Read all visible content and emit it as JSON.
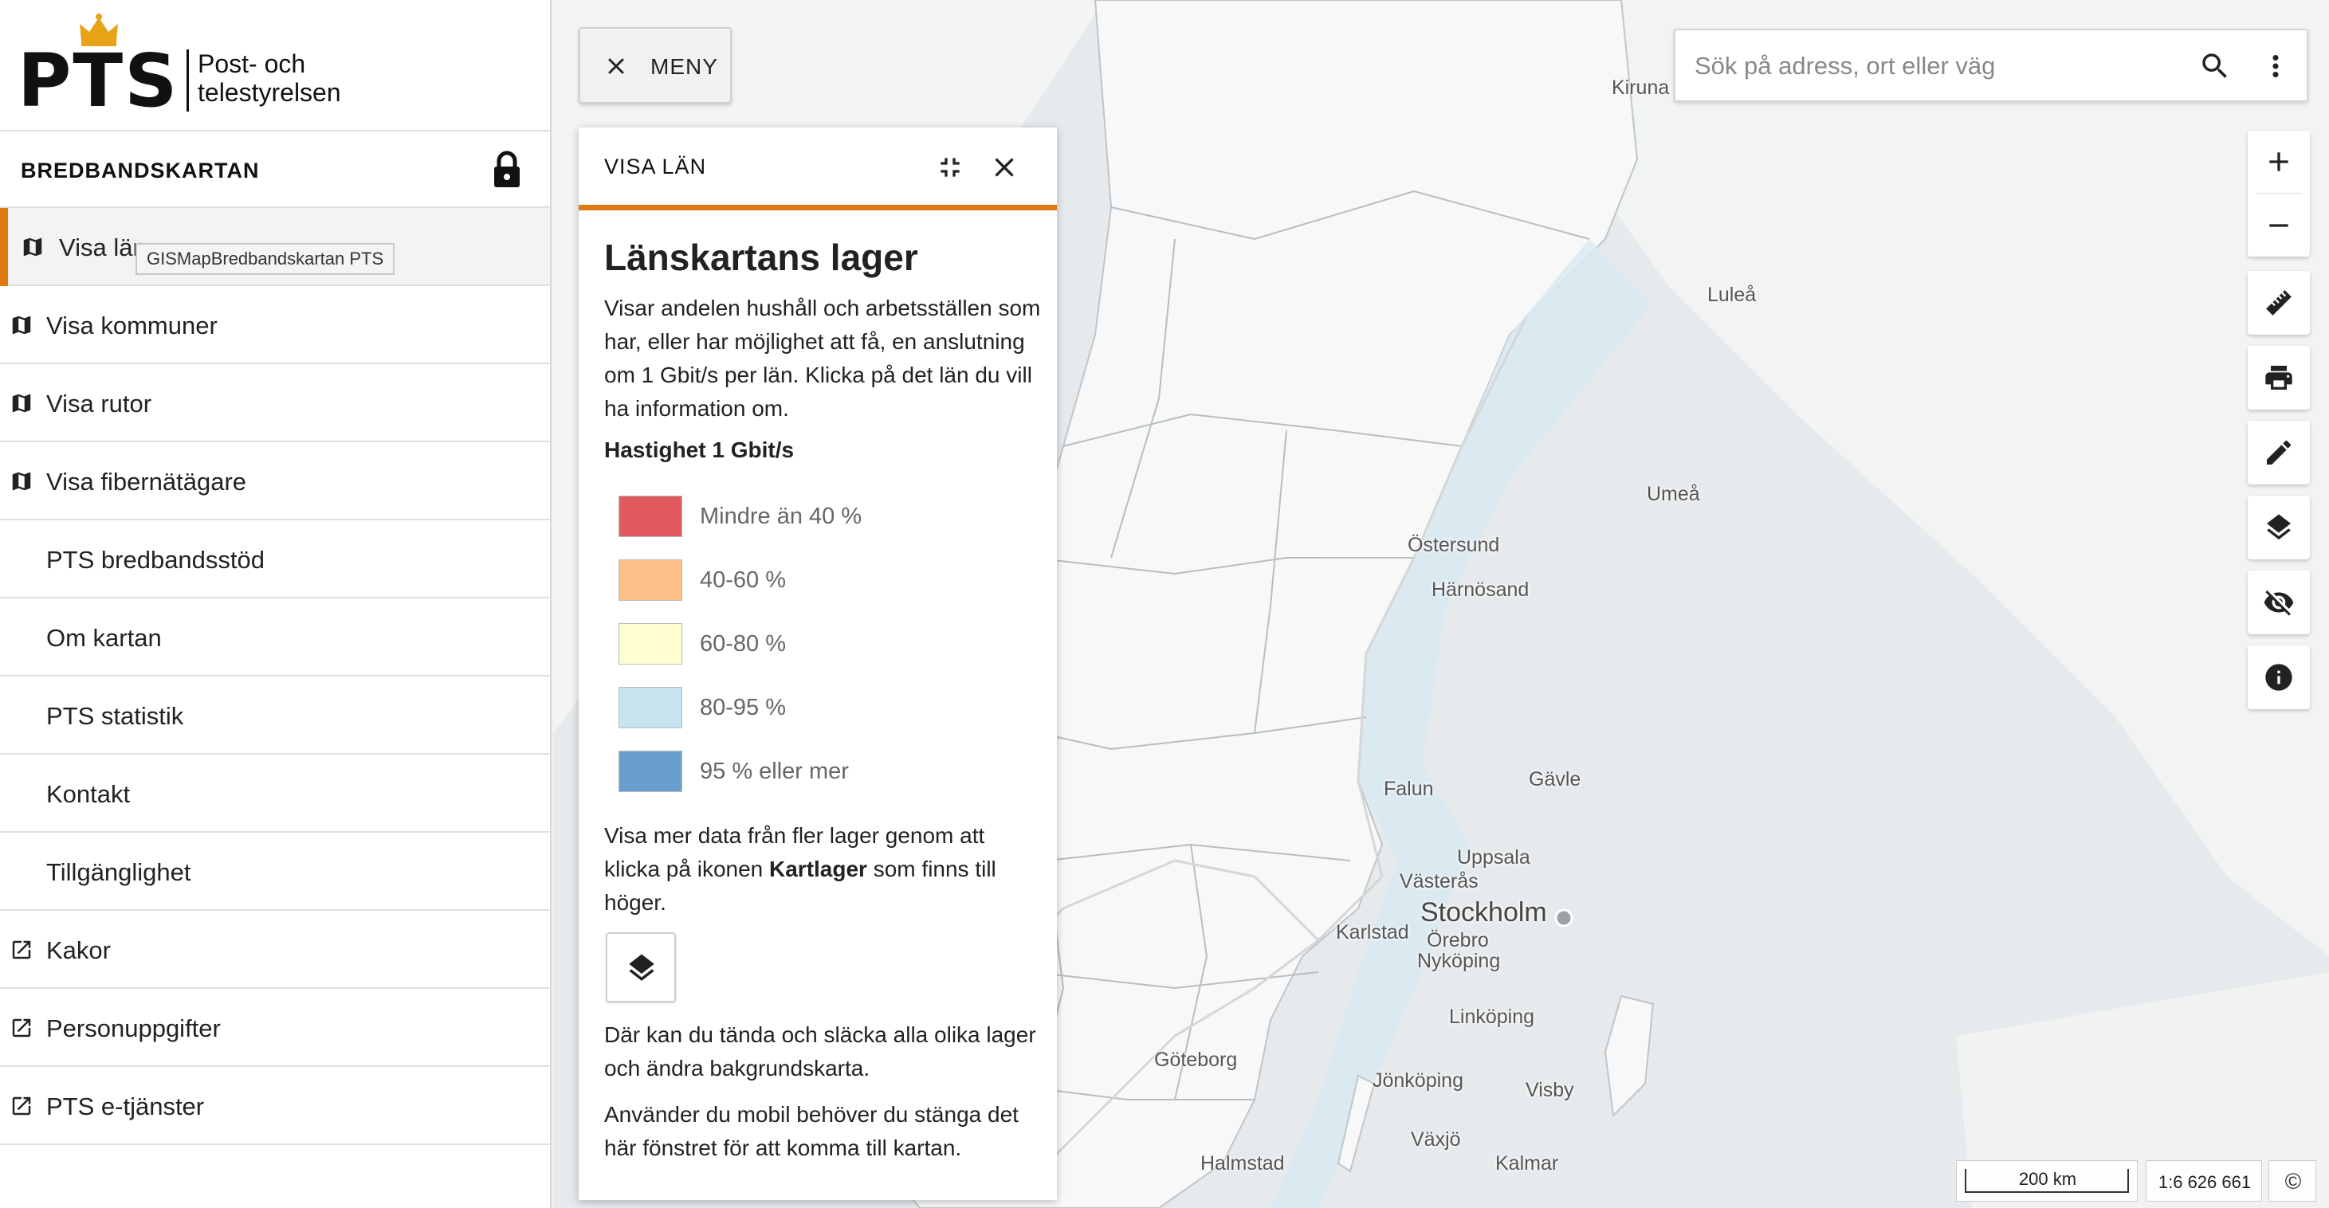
{
  "sidebar": {
    "logo": {
      "wordmark": "PTS",
      "name_line1": "Post- och",
      "name_line2": "telestyrelsen"
    },
    "header_title": "BREDBANDSKARTAN",
    "items": [
      {
        "label": "Visa län",
        "icon": "map-icon"
      },
      {
        "label": "Visa kommuner",
        "icon": "map-icon"
      },
      {
        "label": "Visa rutor",
        "icon": "map-icon"
      },
      {
        "label": "Visa fibernätägare",
        "icon": "map-icon"
      },
      {
        "label": "PTS bredbandsstöd",
        "icon": ""
      },
      {
        "label": "Om kartan",
        "icon": ""
      },
      {
        "label": "PTS statistik",
        "icon": ""
      },
      {
        "label": "Kontakt",
        "icon": ""
      },
      {
        "label": "Tillgänglighet",
        "icon": ""
      },
      {
        "label": "Kakor",
        "icon": "external-link-icon"
      },
      {
        "label": "Personuppgifter",
        "icon": "external-link-icon"
      },
      {
        "label": "PTS e-tjänster",
        "icon": "external-link-icon"
      }
    ],
    "tooltip": "GISMapBredbandskartan PTS"
  },
  "menu_button": {
    "label": "MENY"
  },
  "panel": {
    "header_title": "VISA LÄN",
    "heading": "Länskartans lager",
    "description": "Visar andelen hushåll och arbetsställen som har, eller har möjlighet att få, en anslutning om 1 Gbit/s per län. Klicka på det län du vill ha information om.",
    "legend_title": "Hastighet 1 Gbit/s",
    "legend": [
      {
        "label": "Mindre än 40 %",
        "color": "#e05a5e"
      },
      {
        "label": "40-60 %",
        "color": "#fdbf87"
      },
      {
        "label": "60-80 %",
        "color": "#fefed0"
      },
      {
        "label": "80-95 %",
        "color": "#c6e3ef"
      },
      {
        "label": "95 % eller mer",
        "color": "#6a9fcd"
      }
    ],
    "more_text_before": "Visa mer data från fler lager genom att klicka på ikonen ",
    "more_text_bold": "Kartlager",
    "more_text_after": " som finns till höger.",
    "toggle_text": "Där kan du tända och släcka alla olika lager och ändra bakgrundskarta.",
    "mobile_text": "Använder du mobil behöver du stänga det här fönstret för att komma till kartan."
  },
  "search": {
    "placeholder": "Sök på adress, ort eller väg",
    "value": ""
  },
  "tools": [
    {
      "name": "ruler-icon"
    },
    {
      "name": "print-icon"
    },
    {
      "name": "pencil-icon"
    },
    {
      "name": "layers-icon"
    },
    {
      "name": "eye-off-icon"
    },
    {
      "name": "info-icon"
    }
  ],
  "map": {
    "places": [
      {
        "name": "Kiruna",
        "big": false
      },
      {
        "name": "Luleå",
        "big": false
      },
      {
        "name": "Umeå",
        "big": false
      },
      {
        "name": "Östersund",
        "big": false
      },
      {
        "name": "Härnösand",
        "big": false
      },
      {
        "name": "Falun",
        "big": false
      },
      {
        "name": "Gävle",
        "big": false
      },
      {
        "name": "Uppsala",
        "big": false
      },
      {
        "name": "Västerås",
        "big": false
      },
      {
        "name": "Stockholm",
        "big": true
      },
      {
        "name": "Karlstad",
        "big": false
      },
      {
        "name": "Örebro",
        "big": false
      },
      {
        "name": "Nyköping",
        "big": false
      },
      {
        "name": "Linköping",
        "big": false
      },
      {
        "name": "Göteborg",
        "big": false
      },
      {
        "name": "Jönköping",
        "big": false
      },
      {
        "name": "Visby",
        "big": false
      },
      {
        "name": "Växjö",
        "big": false
      },
      {
        "name": "Halmstad",
        "big": false
      },
      {
        "name": "Kalmar",
        "big": false
      }
    ],
    "scale_label": "200 km",
    "ratio": "1:6 626 661",
    "copyright_symbol": "©"
  }
}
